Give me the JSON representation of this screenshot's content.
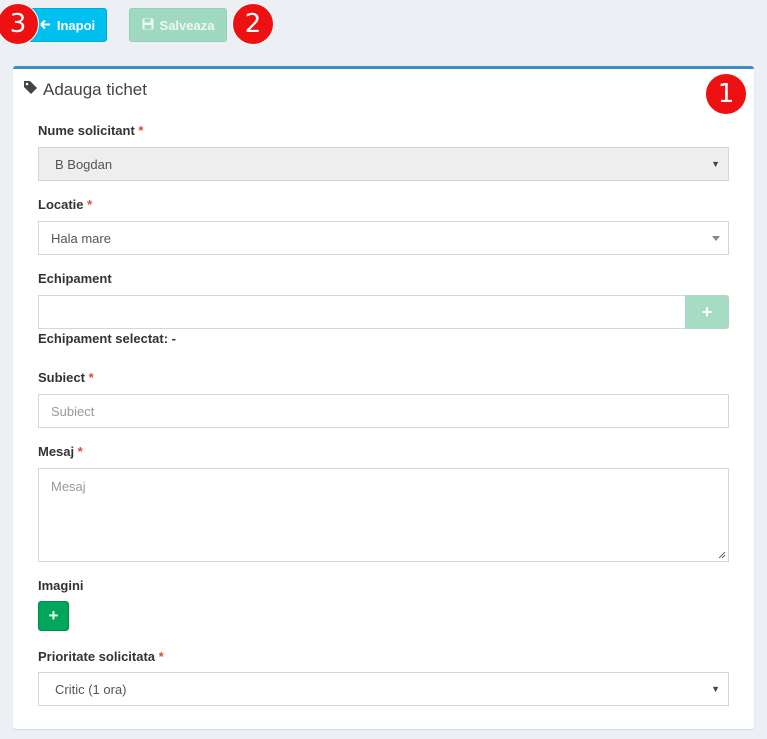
{
  "toolbar": {
    "back_label": "Inapoi",
    "save_label": "Salveaza"
  },
  "badges": [
    "1",
    "2",
    "3"
  ],
  "form": {
    "title": "Adauga tichet",
    "requester": {
      "label": "Nume solicitant",
      "required": "*",
      "value": "B Bogdan"
    },
    "location": {
      "label": "Locatie",
      "required": "*",
      "value": "Hala mare"
    },
    "equipment": {
      "label": "Echipament",
      "value": "",
      "add_symbol": "+",
      "selected_label": "Echipament selectat:",
      "selected_value": "-"
    },
    "subject": {
      "label": "Subiect",
      "required": "*",
      "placeholder": "Subiect"
    },
    "message": {
      "label": "Mesaj",
      "required": "*",
      "placeholder": "Mesaj"
    },
    "images": {
      "label": "Imagini",
      "add_symbol": "+"
    },
    "priority": {
      "label": "Prioritate solicitata",
      "required": "*",
      "value": "Critic (1 ora)"
    }
  },
  "colors": {
    "accent": "#3c8dbc",
    "back_button": "#00c0ef",
    "save_button": "#9fd9c0",
    "add_image_button": "#00a65a",
    "badge": "#ee1111",
    "required_mark": "#dd4b39"
  },
  "icons": {
    "back": "arrow-left-icon",
    "save": "floppy-disk-icon",
    "title": "tag-icon",
    "dropdown": "caret-down-icon"
  }
}
